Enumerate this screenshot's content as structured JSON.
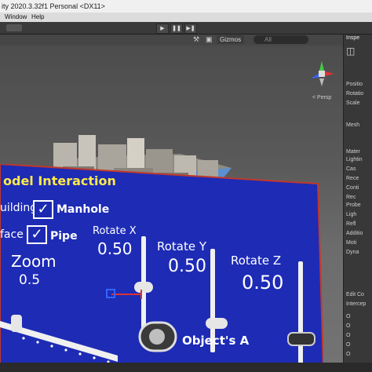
{
  "window": {
    "title": "ity 2020.3.32f1 Personal <DX11>"
  },
  "menu": [
    "Window",
    "Help"
  ],
  "toolbar": {
    "left_label": "◁"
  },
  "play_controls": [
    "▶",
    "❚❚",
    "▶❚"
  ],
  "scene": {
    "gizmos_label": "Gizmos",
    "search_placeholder": "All",
    "persp_label": "< Persp",
    "axis_colors": {
      "x": "#d33",
      "y": "#4c4",
      "z": "#36f"
    }
  },
  "panel": {
    "title": "odel Interaction",
    "checkboxes": [
      {
        "label": "uilding",
        "checked": false
      },
      {
        "label": "Manhole",
        "checked": true
      },
      {
        "label": "face",
        "checked": false
      },
      {
        "label": "Pipe",
        "checked": true
      }
    ],
    "zoom": {
      "label": "Zoom",
      "value": "0.5"
    },
    "rotate_x": {
      "label": "Rotate X",
      "value": "0.50"
    },
    "rotate_y": {
      "label": "Rotate Y",
      "value": "0.50"
    },
    "rotate_z": {
      "label": "Rotate Z",
      "value": "0.50"
    },
    "footer": "Object's A"
  },
  "inspector": {
    "tab": "Inspe",
    "rows": [
      "Positio",
      "Rotatio",
      "Scale",
      "Mesh",
      "Mater",
      "Lightin",
      "Cas",
      "Rece",
      "Conti",
      "Rec",
      "Probe",
      "Ligh",
      "Refl",
      "Additio",
      "Moti",
      "Dyna",
      "Edit Co",
      "Intercep",
      "O",
      "O",
      "O",
      "O",
      "O"
    ]
  }
}
